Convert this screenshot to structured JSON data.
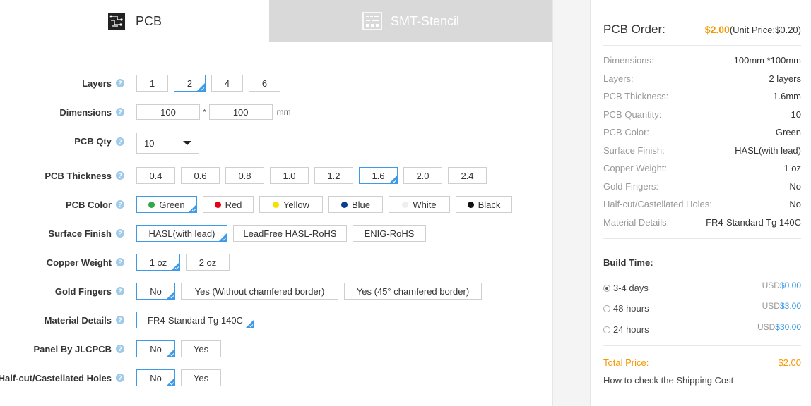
{
  "tabs": [
    {
      "label": "PCB",
      "icon": "pcb-board-icon",
      "active": true
    },
    {
      "label": "SMT-Stencil",
      "icon": "stencil-icon",
      "active": false
    }
  ],
  "form": {
    "layers": {
      "label": "Layers",
      "options": [
        "1",
        "2",
        "4",
        "6"
      ],
      "selected": "2"
    },
    "dimensions": {
      "label": "Dimensions",
      "width": "100",
      "height": "100",
      "separator": "*",
      "unit": "mm"
    },
    "pcb_qty": {
      "label": "PCB Qty",
      "value": "10"
    },
    "thickness": {
      "label": "PCB Thickness",
      "options": [
        "0.4",
        "0.6",
        "0.8",
        "1.0",
        "1.2",
        "1.6",
        "2.0",
        "2.4"
      ],
      "selected": "1.6"
    },
    "color": {
      "label": "PCB Color",
      "options": [
        {
          "name": "Green",
          "hex": "#2eaa4a"
        },
        {
          "name": "Red",
          "hex": "#e60012"
        },
        {
          "name": "Yellow",
          "hex": "#f5e000"
        },
        {
          "name": "Blue",
          "hex": "#0b3f8e"
        },
        {
          "name": "White",
          "hex": "#eeeeee"
        },
        {
          "name": "Black",
          "hex": "#111111"
        }
      ],
      "selected": "Green"
    },
    "surface": {
      "label": "Surface Finish",
      "options": [
        "HASL(with lead)",
        "LeadFree HASL-RoHS",
        "ENIG-RoHS"
      ],
      "selected": "HASL(with lead)"
    },
    "copper": {
      "label": "Copper Weight",
      "options": [
        "1 oz",
        "2 oz"
      ],
      "selected": "1 oz"
    },
    "gold": {
      "label": "Gold Fingers",
      "options": [
        "No",
        "Yes (Without chamfered border)",
        "Yes (45° chamfered border)"
      ],
      "selected": "No"
    },
    "material": {
      "label": "Material Details",
      "options": [
        "FR4-Standard Tg 140C"
      ],
      "selected": "FR4-Standard Tg 140C"
    },
    "panel": {
      "label": "Panel By JLCPCB",
      "options": [
        "No",
        "Yes"
      ],
      "selected": "No"
    },
    "halfcut": {
      "label": "Half-cut/Castellated Holes",
      "options": [
        "No",
        "Yes"
      ],
      "selected": "No"
    },
    "help_glyph": "?"
  },
  "summary": {
    "title": "PCB Order:",
    "price": "$2.00",
    "unit_price": "(Unit Price:$0.20)",
    "specs": [
      {
        "k": "Dimensions:",
        "v": "100mm *100mm"
      },
      {
        "k": "Layers:",
        "v": "2 layers"
      },
      {
        "k": "PCB Thickness:",
        "v": "1.6mm"
      },
      {
        "k": "PCB Quantity:",
        "v": "10"
      },
      {
        "k": "PCB Color:",
        "v": "Green"
      },
      {
        "k": "Surface Finish:",
        "v": "HASL(with lead)"
      },
      {
        "k": "Copper Weight:",
        "v": "1 oz"
      },
      {
        "k": "Gold Fingers:",
        "v": "No"
      },
      {
        "k": "Half-cut/Castellated Holes:",
        "v": "No"
      },
      {
        "k": "Material Details:",
        "v": "FR4-Standard Tg 140C"
      }
    ],
    "build_time_title": "Build Time:",
    "build_times": [
      {
        "label": "3-4 days",
        "currency": "USD",
        "price": "$0.00",
        "selected": true
      },
      {
        "label": "48 hours",
        "currency": "USD",
        "price": "$3.00",
        "selected": false
      },
      {
        "label": "24 hours",
        "currency": "USD",
        "price": "$30.00",
        "selected": false
      }
    ],
    "total_label": "Total Price:",
    "total_value": "$2.00",
    "shipping_link": "How to check the Shipping Cost"
  },
  "colors": {
    "accent": "#3d9ae8",
    "price": "#f39800",
    "tab_inactive": "#d9d9d9"
  }
}
